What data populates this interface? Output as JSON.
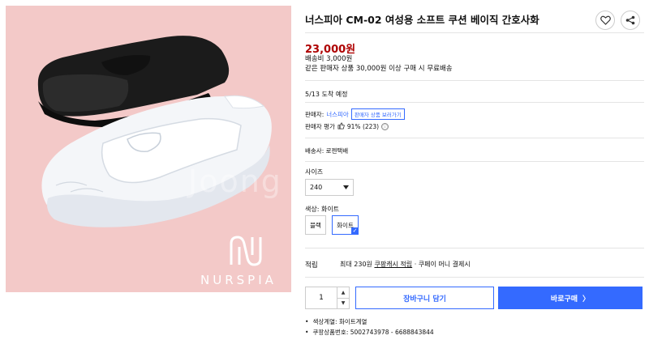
{
  "product": {
    "title": "너스피아 CM-02 여성용 소프트 쿠션 베이직 간호사화",
    "image": {
      "watermark": "Joong",
      "brand_name": "NURSPIA",
      "background_color": "#f3c9c8"
    },
    "price": "23,000원",
    "shipping_fee": "배송비 3,000원",
    "shipping_condition": "같은 판매자 상품 30,000원 이상 구매 시 무료배송",
    "arrival": "5/13 도착 예정",
    "seller": {
      "label": "판매자:",
      "name": "너스피아",
      "button": "판매자 상품 보러가기"
    },
    "rating": {
      "label": "판매자 평가",
      "icon": "thumbs-up-icon",
      "value": "91% (223)",
      "info_icon": "ⓘ"
    },
    "delivery": "배송사: 로젠택배",
    "size": {
      "label": "사이즈",
      "selected": "240"
    },
    "color": {
      "label": "색상: 화이트",
      "options": [
        "블랙",
        "화이트"
      ],
      "selected": "화이트"
    },
    "reward": {
      "label": "적립",
      "prefix": "최대 230원",
      "link": "쿠팡캐시 적립",
      "suffix": "· 쿠페이 머니 결제시"
    },
    "quantity": "1",
    "cart_button": "장바구니 담기",
    "buy_button": "바로구매",
    "buy_arrow": "〉",
    "details": [
      "색상계열: 화이트계열",
      "쿠팡상품번호: 5002743978 - 6688843844"
    ],
    "colors": {
      "accent": "#346aff",
      "price": "#ae0000"
    }
  }
}
